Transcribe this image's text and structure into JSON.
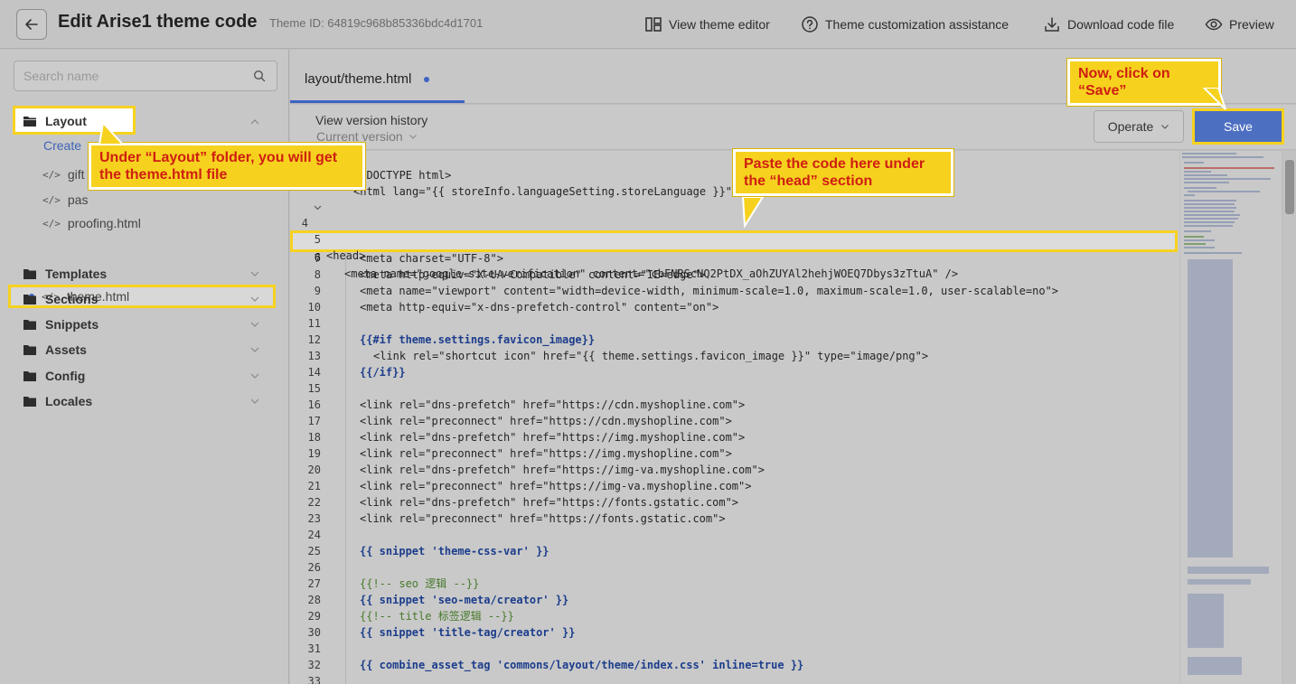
{
  "header": {
    "title": "Edit Arise1 theme code",
    "theme_id": "Theme ID: 64819c968b85336bdc4d1701",
    "actions": {
      "view_editor": "View theme editor",
      "assistance": "Theme customization assistance",
      "download": "Download code file",
      "preview": "Preview"
    }
  },
  "sidebar": {
    "search_placeholder": "Search name",
    "layout_folder": "Layout",
    "create_link": "Create",
    "files": [
      "gift",
      "pas",
      "proofing.html",
      "theme.html"
    ],
    "folders": [
      "Templates",
      "Sections",
      "Snippets",
      "Assets",
      "Config",
      "Locales"
    ]
  },
  "editor": {
    "tab_name": "layout/theme.html",
    "view_version_history": "View version history",
    "current_version": "Current version",
    "operate_label": "Operate",
    "save_label": "Save",
    "line_numbers": [
      "4",
      "5",
      "6",
      "7",
      "8",
      "9",
      "10",
      "11",
      "12",
      "13",
      "14",
      "15",
      "16",
      "17",
      "18",
      "19",
      "20",
      "21",
      "22",
      "23",
      "24",
      "25",
      "26",
      "27",
      "28",
      "29",
      "30",
      "31",
      "32",
      "33"
    ],
    "code": {
      "l1": "<!DOCTYPE html>",
      "l2": "<html lang=\"{{ storeInfo.languageSetting.storeLanguage }}\">",
      "l4": "<head>",
      "l6": "<meta name=\"google-site-verification\" content=\"cbFNRScNQ2PtDX_aOhZUYAl2hehjWOEQ7Dbys3zTtuA\" />",
      "l7": "<meta charset=\"UTF-8\">",
      "l8": "<meta http-equiv=\"X-UA-Compatible\" content=\"IE=edge\">",
      "l9": "<meta name=\"viewport\" content=\"width=device-width, minimum-scale=1.0, maximum-scale=1.0, user-scalable=no\">",
      "l10": "<meta http-equiv=\"x-dns-prefetch-control\" content=\"on\">",
      "l12": "{{#if theme.settings.favicon_image}}",
      "l13": "<link rel=\"shortcut icon\" href=\"{{ theme.settings.favicon_image }}\" type=\"image/png\">",
      "l14": "{{/if}}",
      "l16": "<link rel=\"dns-prefetch\" href=\"https://cdn.myshopline.com\">",
      "l17": "<link rel=\"preconnect\" href=\"https://cdn.myshopline.com\">",
      "l18": "<link rel=\"dns-prefetch\" href=\"https://img.myshopline.com\">",
      "l19": "<link rel=\"preconnect\" href=\"https://img.myshopline.com\">",
      "l20": "<link rel=\"dns-prefetch\" href=\"https://img-va.myshopline.com\">",
      "l21": "<link rel=\"preconnect\" href=\"https://img-va.myshopline.com\">",
      "l22": "<link rel=\"dns-prefetch\" href=\"https://fonts.gstatic.com\">",
      "l23": "<link rel=\"preconnect\" href=\"https://fonts.gstatic.com\">",
      "l25": "{{ snippet 'theme-css-var' }}",
      "l27": "{{!-- seo 逻辑 --}}",
      "l28": "{{ snippet 'seo-meta/creator' }}",
      "l29": "{{!-- title 标签逻辑 --}}",
      "l30": "{{ snippet 'title-tag/creator' }}",
      "l32": "{{ combine_asset_tag 'commons/layout/theme/index.css' inline=true }}"
    }
  },
  "callouts": {
    "save": "Now, click on “Save”",
    "layout": "Under “Layout” folder, you will get the theme.html file",
    "paste": "Paste the code here under the “head” section"
  }
}
